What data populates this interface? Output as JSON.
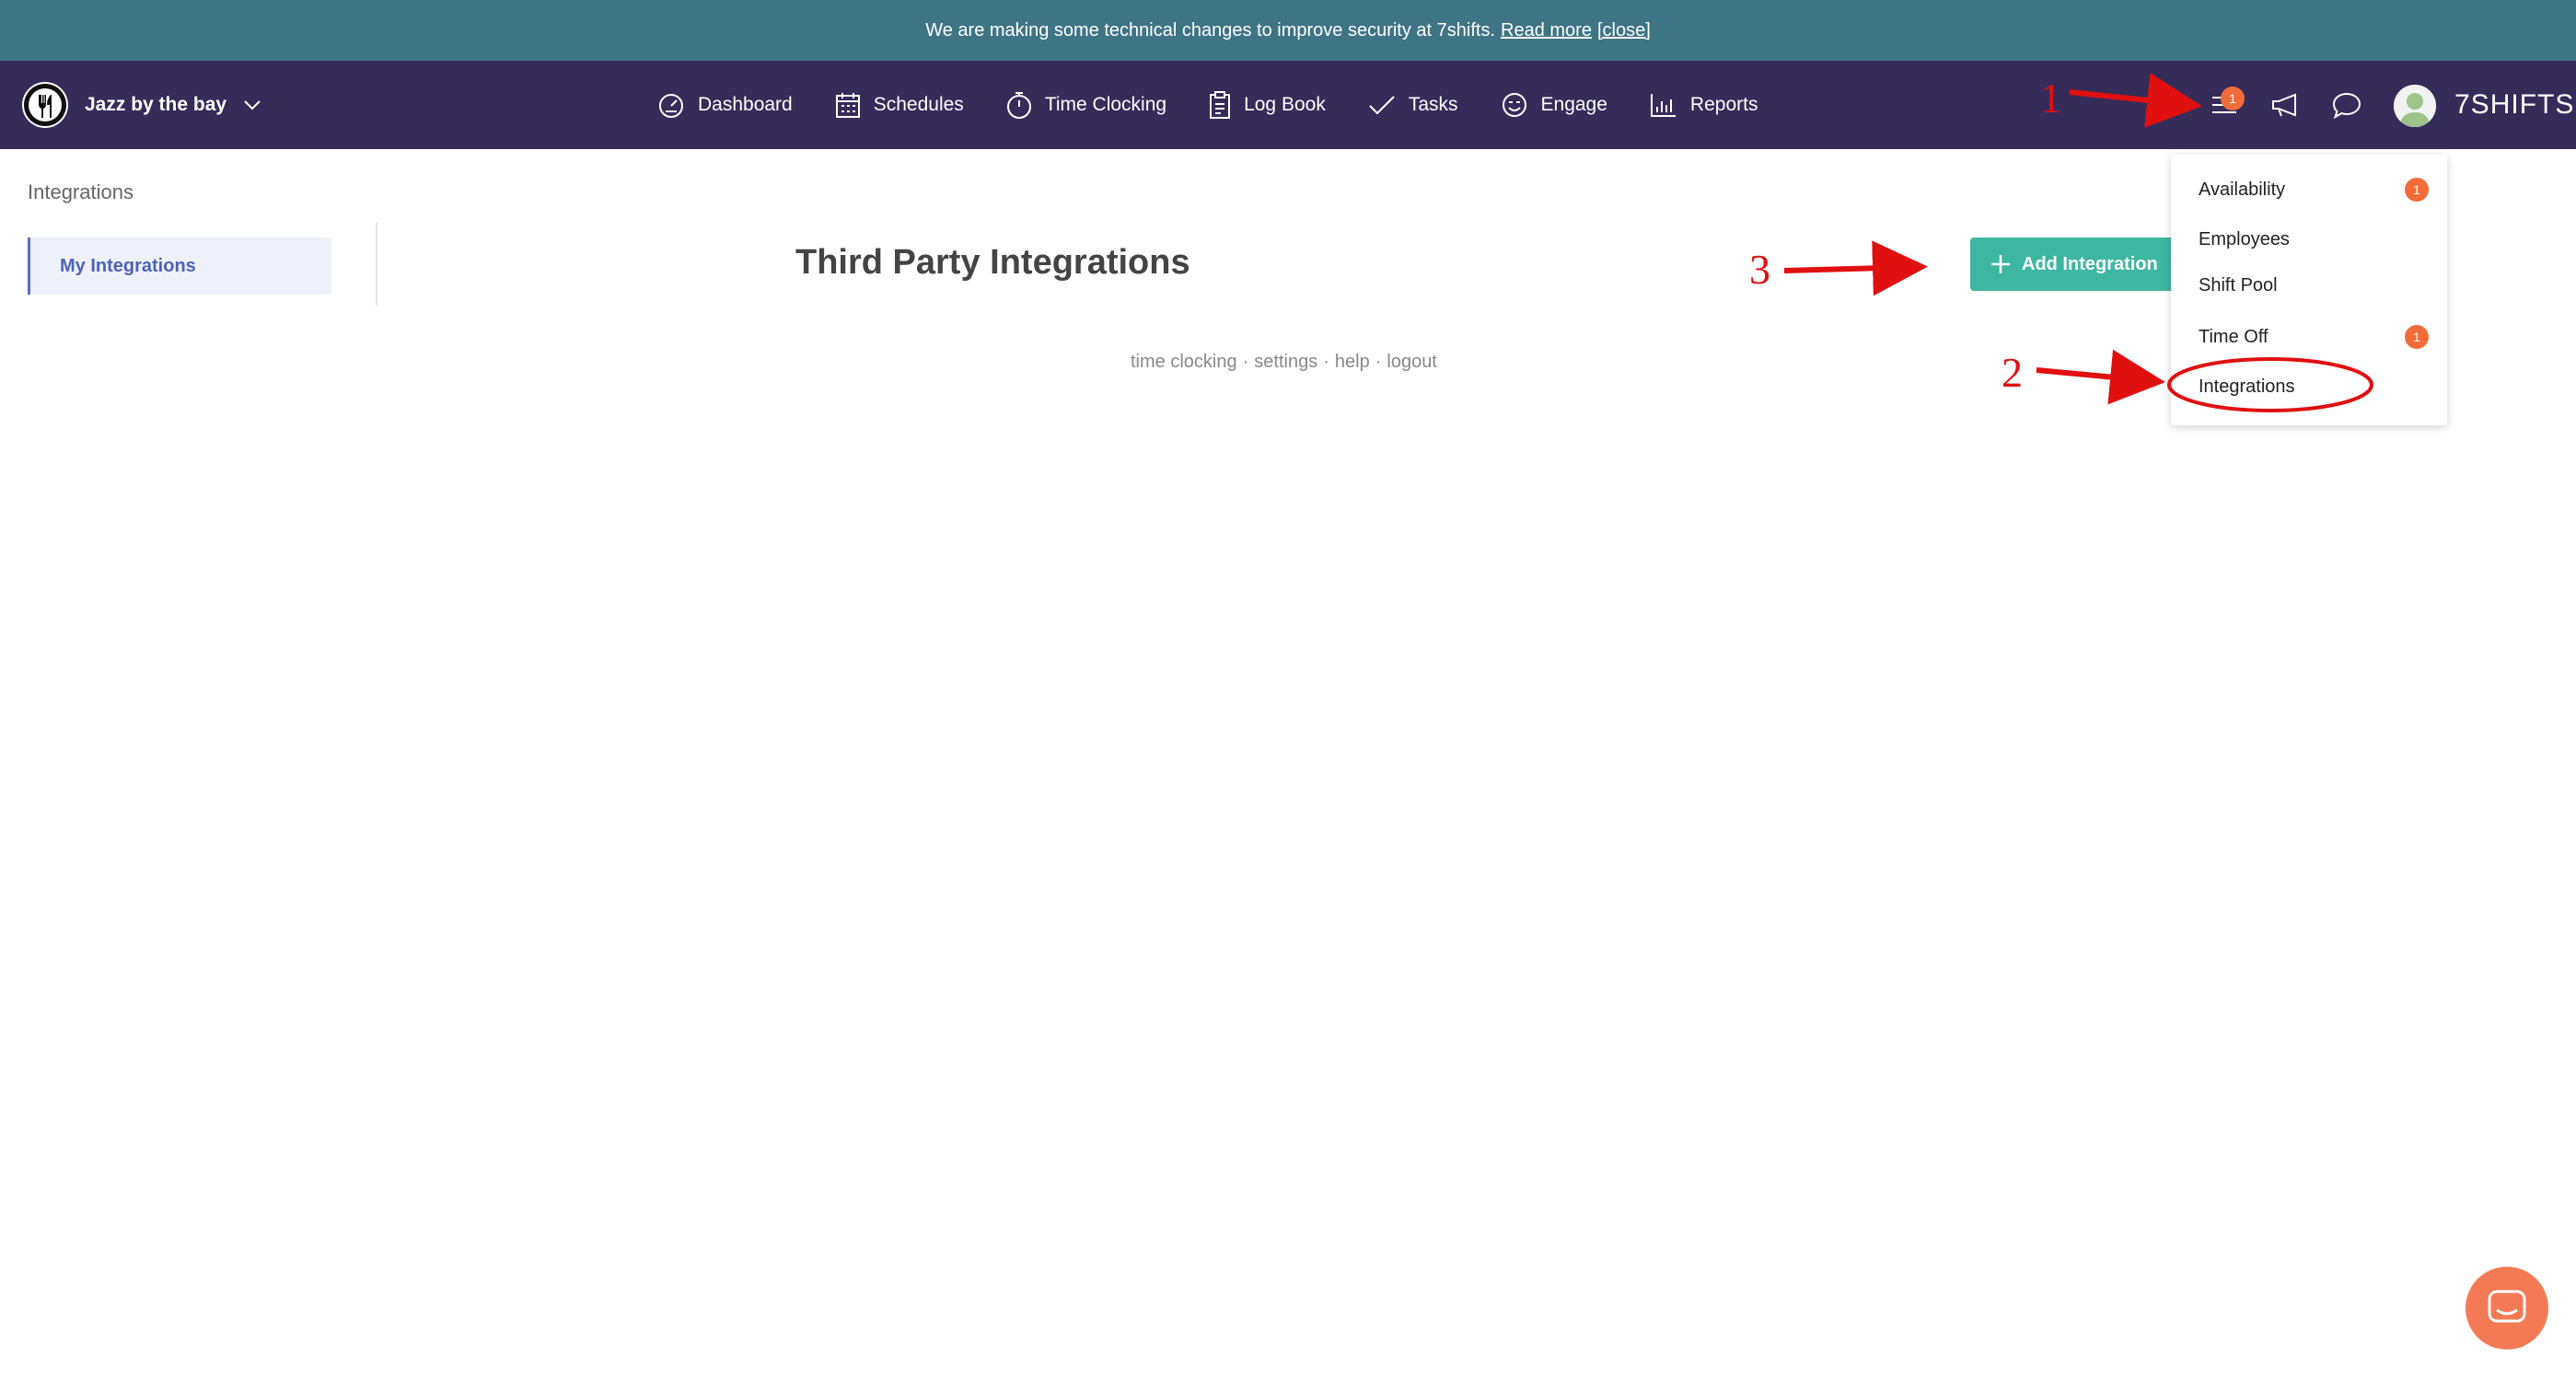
{
  "banner": {
    "message": "We are making some technical changes to improve security at 7shifts.",
    "read_more": "Read more",
    "close": "[close]"
  },
  "navbar": {
    "company_name": "Jazz by the bay",
    "items": [
      {
        "label": "Dashboard",
        "icon": "gauge-icon"
      },
      {
        "label": "Schedules",
        "icon": "calendar-icon"
      },
      {
        "label": "Time Clocking",
        "icon": "stopwatch-icon"
      },
      {
        "label": "Log Book",
        "icon": "clipboard-icon"
      },
      {
        "label": "Tasks",
        "icon": "checkmark-icon"
      },
      {
        "label": "Engage",
        "icon": "smiley-icon"
      },
      {
        "label": "Reports",
        "icon": "bar-chart-icon"
      }
    ],
    "menu_badge": "1",
    "logo_text": "7SHIFTS"
  },
  "sidebar": {
    "title": "Integrations",
    "items": [
      {
        "label": "My Integrations"
      }
    ]
  },
  "main": {
    "title": "Third Party Integrations",
    "add_button": "Add Integration",
    "footer_links": [
      "time clocking",
      "settings",
      "help",
      "logout"
    ],
    "footer_separator": "·"
  },
  "dropdown": {
    "items": [
      {
        "label": "Availability",
        "badge": "1"
      },
      {
        "label": "Employees",
        "badge": ""
      },
      {
        "label": "Shift Pool",
        "badge": ""
      },
      {
        "label": "Time Off",
        "badge": "1"
      },
      {
        "label": "Integrations",
        "badge": ""
      }
    ]
  },
  "annotations": {
    "step1": "1",
    "step2": "2",
    "step3": "3",
    "color": "#e01010"
  },
  "colors": {
    "banner": "#3e7585",
    "navbar": "#352c5a",
    "accent_green": "#3eb7a0",
    "badge": "#f26c3a",
    "sidebar_active": "#4d63b8"
  }
}
